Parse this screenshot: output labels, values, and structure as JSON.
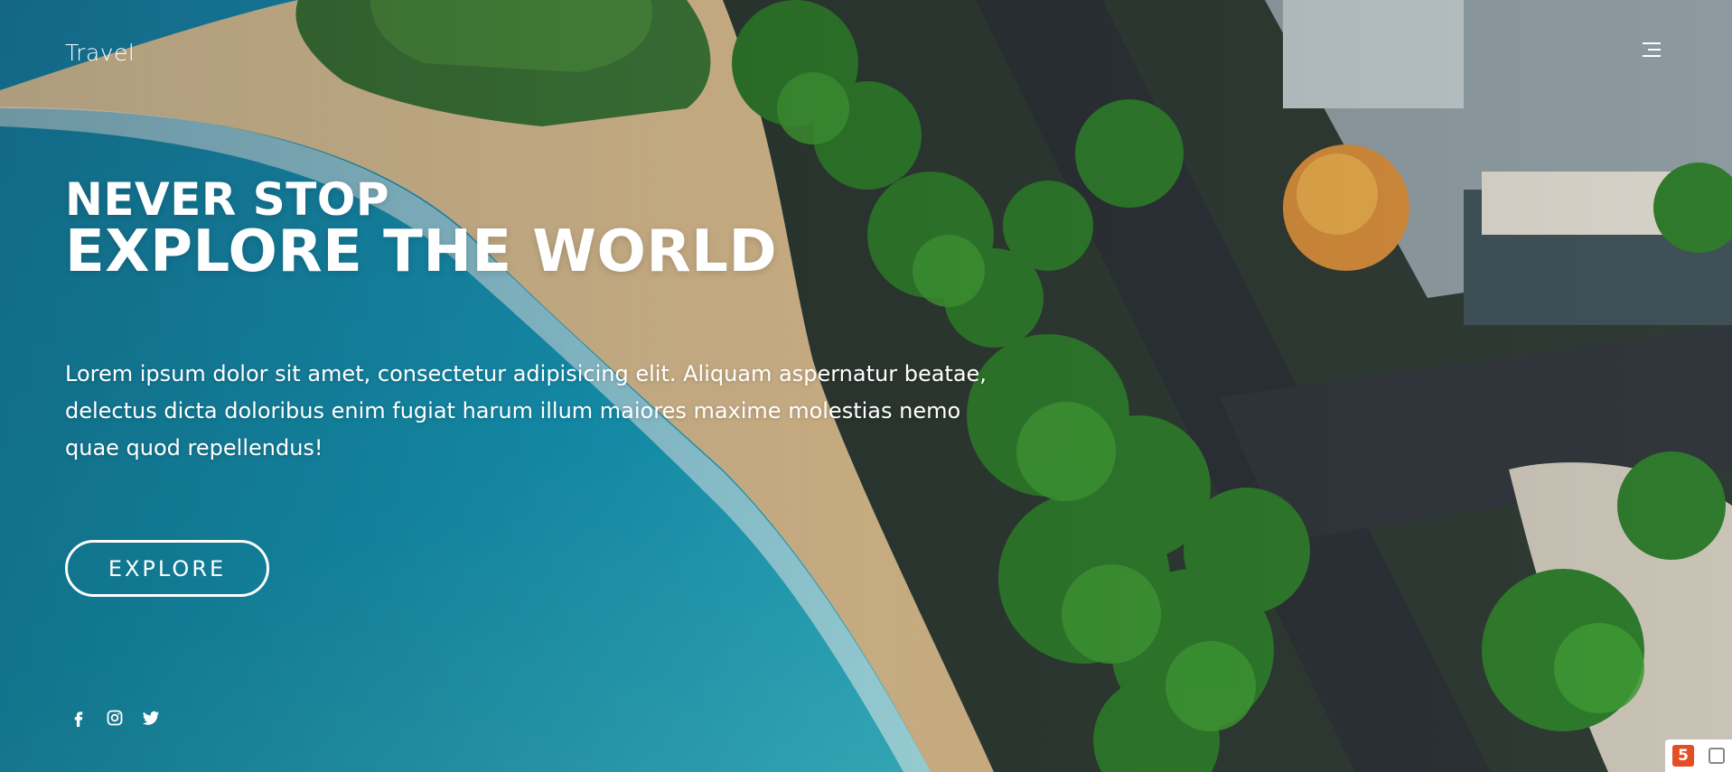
{
  "brand": {
    "name": "Travel"
  },
  "nav": {
    "menu_icon": "hamburger-icon"
  },
  "hero": {
    "heading_line1": "NEVER STOP",
    "heading_line2": "EXPLORE THE WORLD",
    "description": "Lorem ipsum dolor sit amet, consectetur adipisicing elit. Aliquam aspernatur beatae, delectus dicta doloribus enim fugiat harum illum maiores maxime molestias nemo quae quod repellendus!",
    "cta_label": "EXPLORE"
  },
  "social": [
    {
      "icon": "facebook-icon"
    },
    {
      "icon": "instagram-icon"
    },
    {
      "icon": "twitter-icon"
    }
  ],
  "colors": {
    "text": "#ffffff",
    "ocean": "#1b8fb4",
    "sand": "#e9cfa2",
    "palm": "#2e6b2a",
    "road": "#2c3236"
  }
}
